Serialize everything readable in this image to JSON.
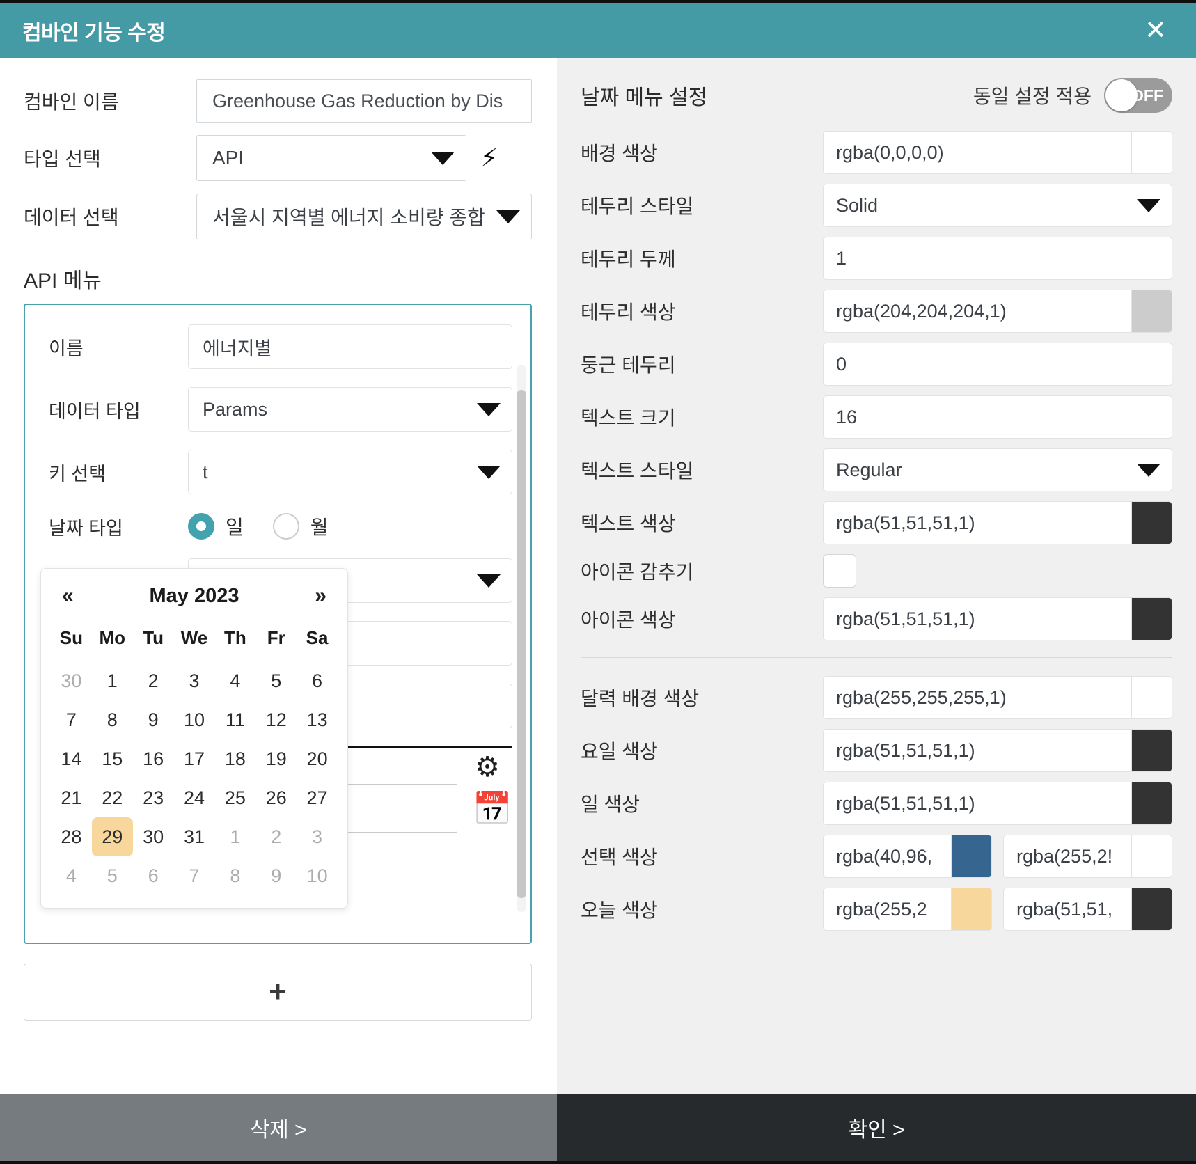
{
  "titlebar": {
    "title": "컴바인 기능 수정",
    "close_icon": "close-icon"
  },
  "left": {
    "fields": {
      "name_label": "컴바인 이름",
      "name_value": "Greenhouse Gas Reduction by Dis",
      "type_label": "타입 선택",
      "type_value": "API",
      "bolt_icon": "⚡",
      "data_label": "데이터 선택",
      "data_value": "서울시 지역별 에너지 소비량 종합"
    },
    "api_menu_title": "API 메뉴",
    "api_card": {
      "name_label": "이름",
      "name_value": "에너지별",
      "datatype_label": "데이터 타입",
      "datatype_value": "Params",
      "key_label": "키 선택",
      "key_value": "t",
      "datetype_label": "날짜 타입",
      "radio_day": "일",
      "radio_month": "월",
      "gear_icon": "gear-icon",
      "calendar_icon": "calendar-icon",
      "date_input_value": ""
    },
    "datepicker": {
      "prev": "«",
      "next": "»",
      "month_title": "May 2023",
      "dow": [
        "Su",
        "Mo",
        "Tu",
        "We",
        "Th",
        "Fr",
        "Sa"
      ],
      "weeks": [
        [
          {
            "d": "30",
            "mute": true
          },
          {
            "d": "1"
          },
          {
            "d": "2"
          },
          {
            "d": "3"
          },
          {
            "d": "4"
          },
          {
            "d": "5"
          },
          {
            "d": "6"
          }
        ],
        [
          {
            "d": "7"
          },
          {
            "d": "8"
          },
          {
            "d": "9"
          },
          {
            "d": "10"
          },
          {
            "d": "11"
          },
          {
            "d": "12"
          },
          {
            "d": "13"
          }
        ],
        [
          {
            "d": "14"
          },
          {
            "d": "15"
          },
          {
            "d": "16"
          },
          {
            "d": "17"
          },
          {
            "d": "18"
          },
          {
            "d": "19"
          },
          {
            "d": "20"
          }
        ],
        [
          {
            "d": "21"
          },
          {
            "d": "22"
          },
          {
            "d": "23"
          },
          {
            "d": "24"
          },
          {
            "d": "25"
          },
          {
            "d": "26"
          },
          {
            "d": "27"
          }
        ],
        [
          {
            "d": "28"
          },
          {
            "d": "29",
            "today": true
          },
          {
            "d": "30"
          },
          {
            "d": "31"
          },
          {
            "d": "1",
            "mute": true
          },
          {
            "d": "2",
            "mute": true
          },
          {
            "d": "3",
            "mute": true
          }
        ],
        [
          {
            "d": "4",
            "mute": true
          },
          {
            "d": "5",
            "mute": true
          },
          {
            "d": "6",
            "mute": true
          },
          {
            "d": "7",
            "mute": true
          },
          {
            "d": "8",
            "mute": true
          },
          {
            "d": "9",
            "mute": true
          },
          {
            "d": "10",
            "mute": true
          }
        ]
      ]
    },
    "add_button_label": "+"
  },
  "right": {
    "header": {
      "title": "날짜 메뉴 설정",
      "toggle_label": "동일 설정 적용",
      "toggle_state": "OFF"
    },
    "rows": [
      {
        "label": "배경 색상",
        "value": "rgba(0,0,0,0)",
        "kind": "color",
        "swatch": "rgba(0,0,0,0)"
      },
      {
        "label": "테두리 스타일",
        "value": "Solid",
        "kind": "select"
      },
      {
        "label": "테두리 두께",
        "value": "1",
        "kind": "text"
      },
      {
        "label": "테두리 색상",
        "value": "rgba(204,204,204,1)",
        "kind": "color",
        "swatch": "#cccccc"
      },
      {
        "label": "둥근 테두리",
        "value": "0",
        "kind": "text"
      },
      {
        "label": "텍스트 크기",
        "value": "16",
        "kind": "text"
      },
      {
        "label": "텍스트 스타일",
        "value": "Regular",
        "kind": "select"
      },
      {
        "label": "텍스트 색상",
        "value": "rgba(51,51,51,1)",
        "kind": "color",
        "swatch": "#333333"
      },
      {
        "label": "아이콘 감추기",
        "value": "",
        "kind": "checkbox"
      },
      {
        "label": "아이콘 색상",
        "value": "rgba(51,51,51,1)",
        "kind": "color",
        "swatch": "#333333"
      }
    ],
    "rows2": [
      {
        "label": "달력 배경 색상",
        "value": "rgba(255,255,255,1)",
        "kind": "color",
        "swatch": "#ffffff"
      },
      {
        "label": "요일 색상",
        "value": "rgba(51,51,51,1)",
        "kind": "color",
        "swatch": "#333333"
      },
      {
        "label": "일 색상",
        "value": "rgba(51,51,51,1)",
        "kind": "color",
        "swatch": "#333333"
      },
      {
        "label": "선택 색상",
        "kind": "split",
        "value_a": "rgba(40,96,",
        "swatch_a": "#36658f",
        "value_b": "rgba(255,2!",
        "swatch_b": "#ffffff"
      },
      {
        "label": "오늘 색상",
        "kind": "split",
        "value_a": "rgba(255,2",
        "swatch_a": "#f7d79b",
        "value_b": "rgba(51,51,",
        "swatch_b": "#333333"
      }
    ]
  },
  "footer": {
    "delete_label": "삭제 >",
    "confirm_label": "확인 >"
  }
}
